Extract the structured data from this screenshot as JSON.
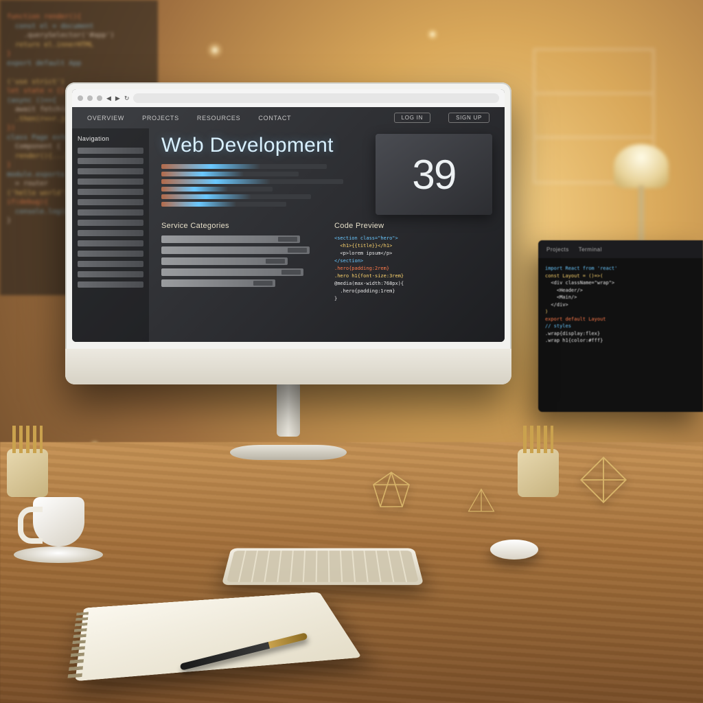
{
  "page": {
    "title": "Web Development",
    "nav": [
      "Overview",
      "Projects",
      "Resources",
      "Contact"
    ],
    "nav_pill_a": "Log in",
    "nav_pill_b": "Sign up",
    "sidebar_header": "Navigation",
    "section_left_title": "Service Categories",
    "section_right_title": "Code Preview",
    "metric_number": "39"
  },
  "secondary_monitor": {
    "tabs": [
      "Projects",
      "Terminal"
    ]
  }
}
